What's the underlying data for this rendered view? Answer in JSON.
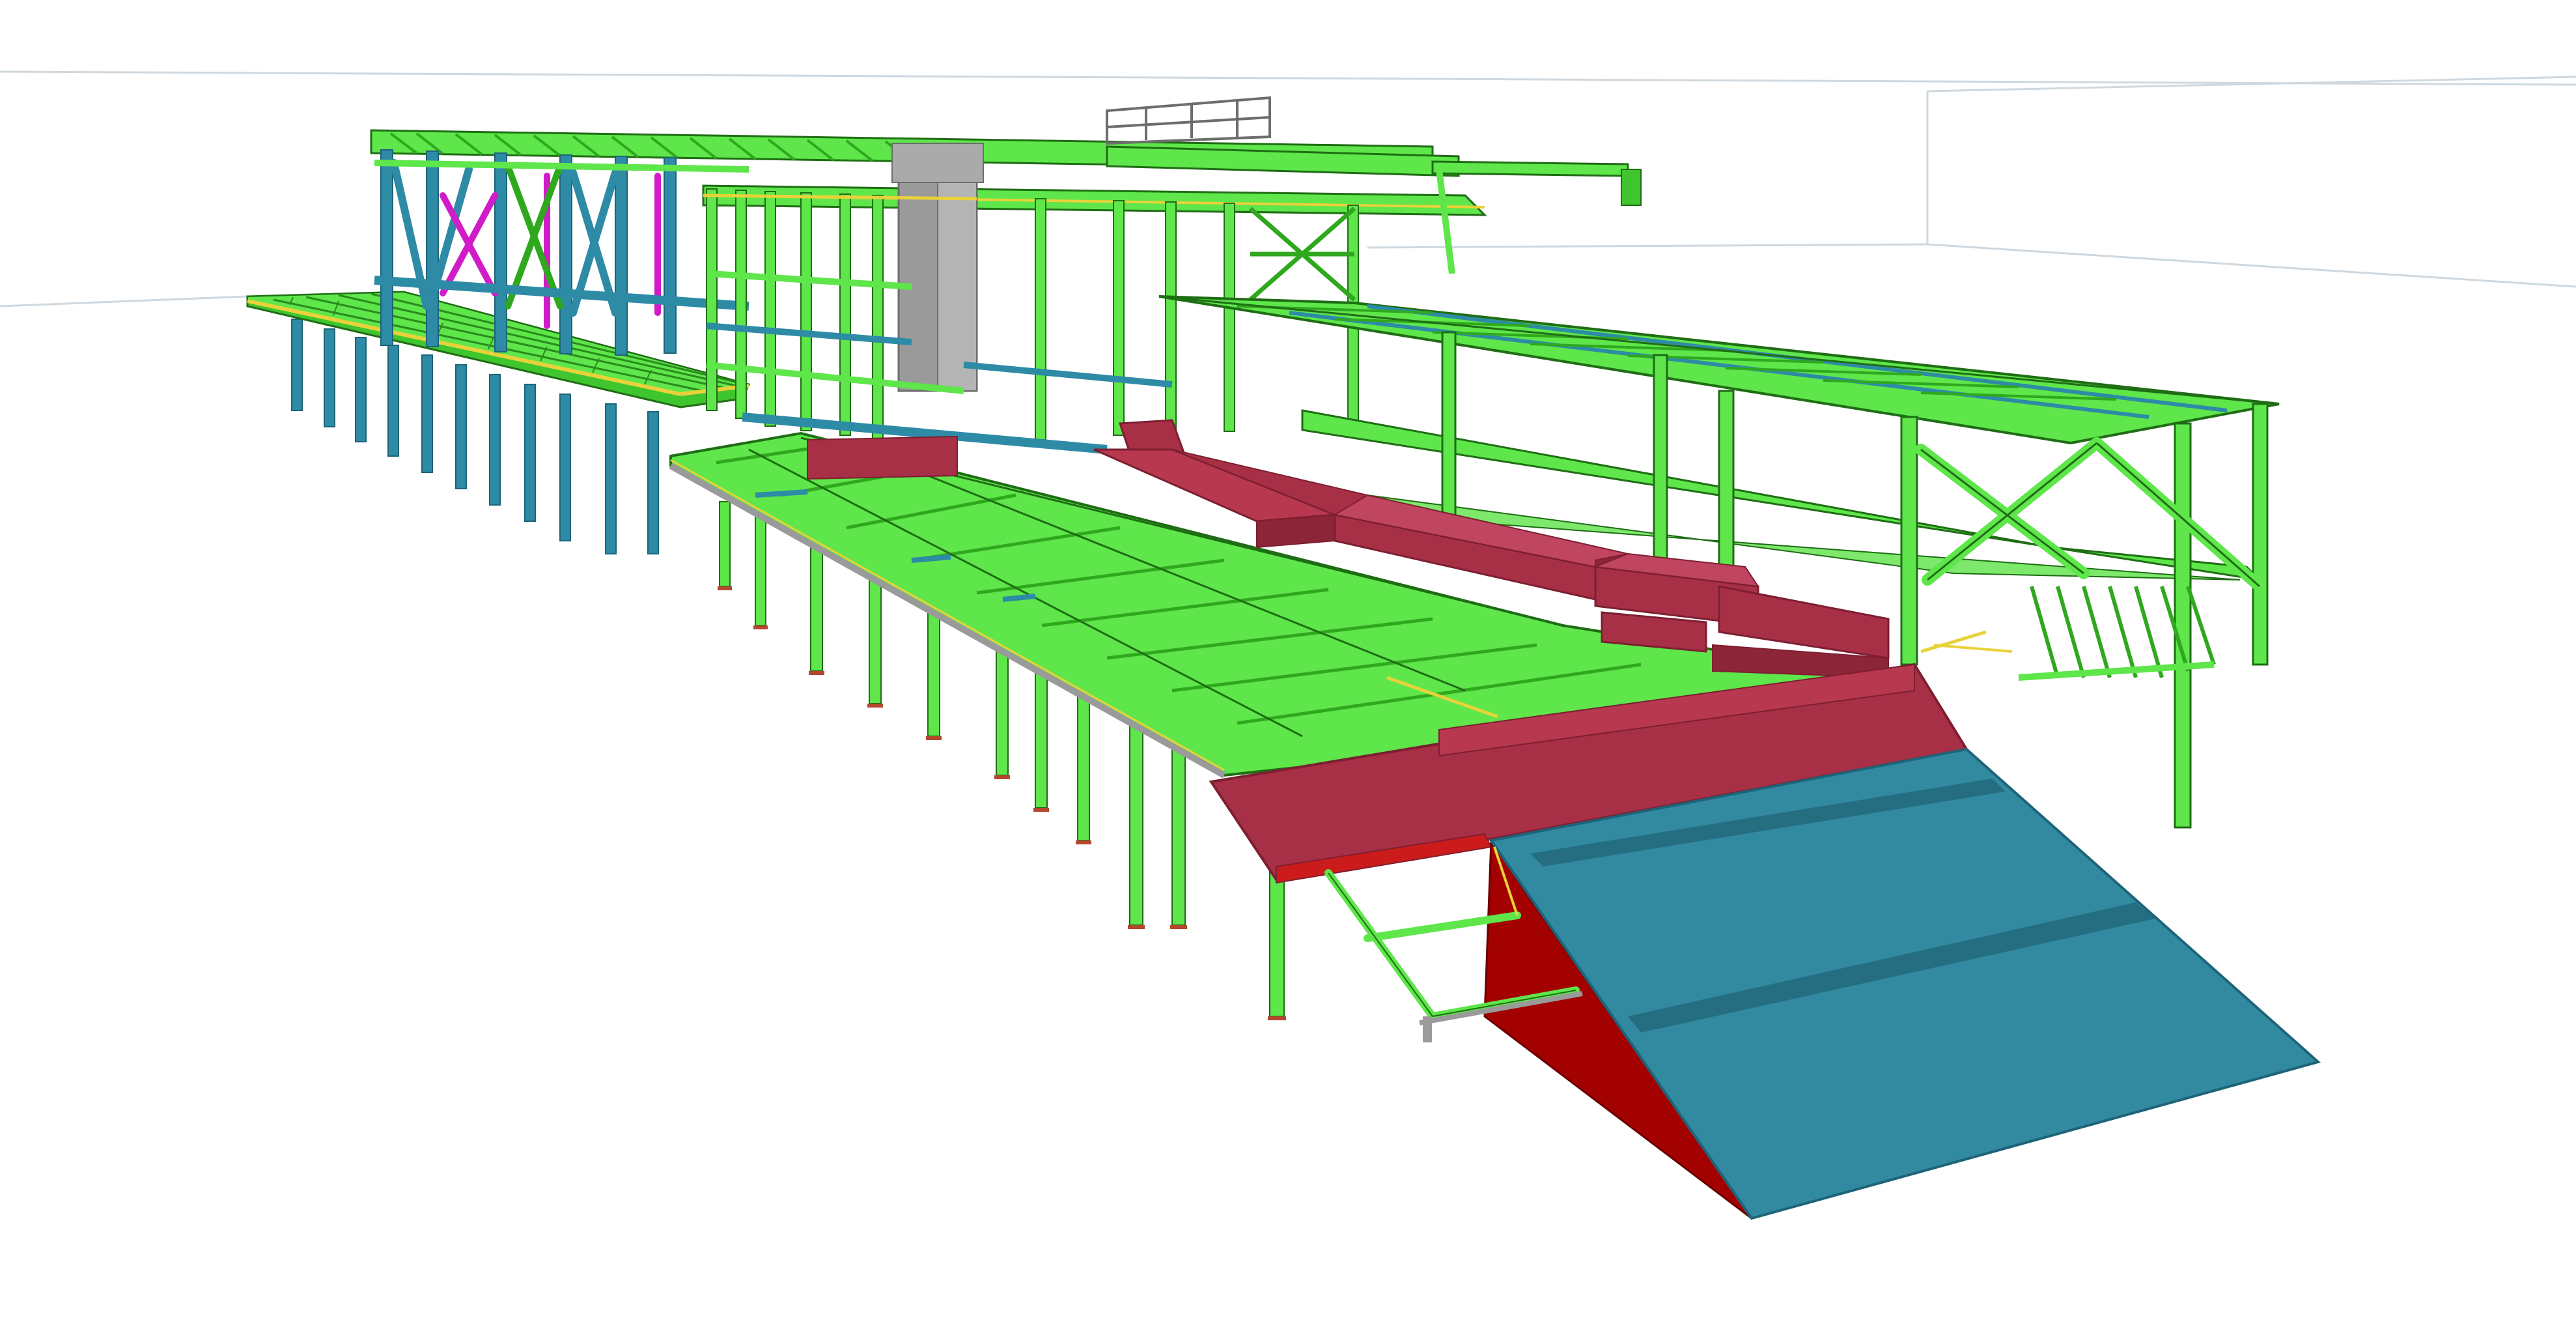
{
  "colors": {
    "background": "#ffffff",
    "horizon_line": "#cfd8de",
    "beam_green": "#5ee64b",
    "beam_green_dark": "#2fa81e",
    "beam_outline": "#1f6d14",
    "column_blue": "#2e8ba6",
    "column_blue_dark": "#1d6479",
    "slab_red": "#a83046",
    "slab_red_dark": "#7d1f31",
    "wedge_red": "#a30000",
    "ramp_teal": "#328aa1",
    "ramp_teal_dark": "#256e82",
    "brace_magenta": "#d21bc8",
    "gray_core": "#9a9a9a",
    "gray_core_dark": "#6d6d6d",
    "yellow_edge": "#e8d23a",
    "base_plate": "#b4472e"
  },
  "icons": {
    "model": "structural-steel-3d-model"
  }
}
